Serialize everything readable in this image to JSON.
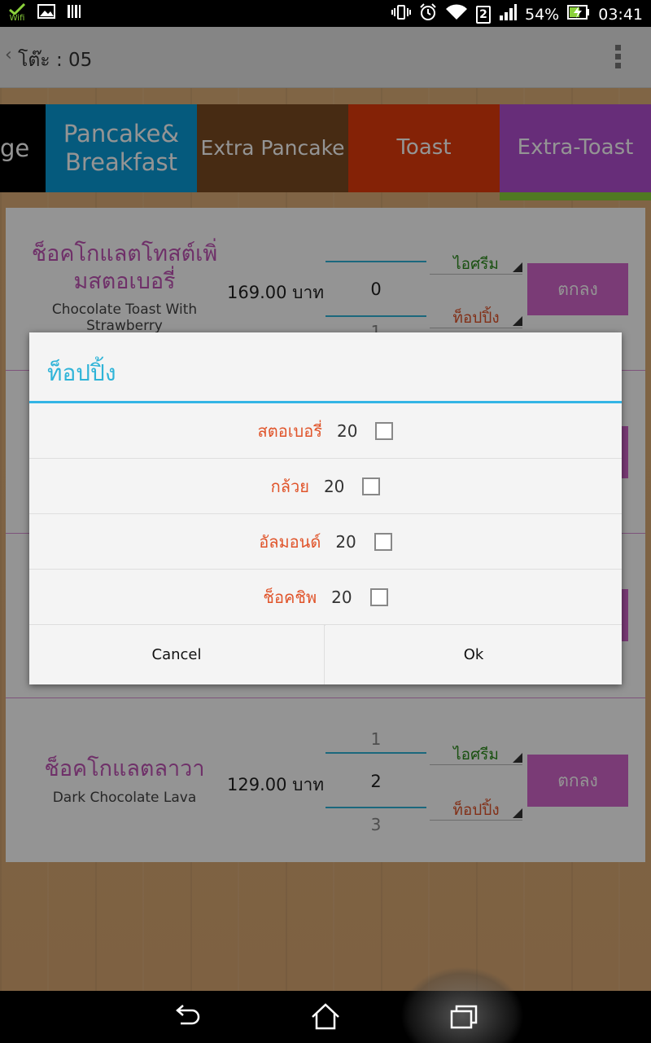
{
  "status_bar": {
    "wifi_label": "Wifi",
    "battery_percent": "54%",
    "time": "03:41",
    "sim_badge": "2",
    "icons": [
      "wifi-app-icon",
      "image-icon",
      "barcode-icon",
      "vibrate-icon",
      "alarm-icon",
      "wifi-signal-icon",
      "sim-icon",
      "cell-signal-icon",
      "battery-charging-icon"
    ]
  },
  "action_bar": {
    "back_glyph": "‹",
    "title": "โต๊ะ : 05"
  },
  "tabs": [
    {
      "label": "ge"
    },
    {
      "label": "Pancake&\nBreakfast"
    },
    {
      "label": "Extra Pancake"
    },
    {
      "label": "Toast"
    },
    {
      "label": "Extra-Toast"
    }
  ],
  "items": [
    {
      "name_th": "ช็อคโกแลตโทสต์เพิ่มสตอเบอรี่",
      "name_th_line1": "ช็อคโกแลตโทสต์เพิ่",
      "name_th_line2": "มสตอเบอรี่",
      "name_en": "Chocolate Toast With",
      "name_en2": "Strawberry",
      "price": "169.00 บาท",
      "qty": "0",
      "qty_next": "1",
      "spinner1": "ไอศรีม",
      "spinner2": "ท็อปปิ้ง",
      "ok_label": "ตกลง"
    },
    {
      "name_th": "ช็อคโกแลตลาวา",
      "name_en": "Dark Chocolate Lava",
      "price": "129.00 บาท",
      "qty_prev": "1",
      "qty": "2",
      "qty_next": "3",
      "spinner1": "ไอศรีม",
      "spinner2": "ท็อปปิ้ง",
      "ok_label": "ตกลง"
    }
  ],
  "dialog": {
    "title": "ท็อปปิ้ง",
    "options": [
      {
        "label": "สตอเบอรี่",
        "price": "20",
        "checked": false
      },
      {
        "label": "กล้วย",
        "price": "20",
        "checked": false
      },
      {
        "label": "อัลมอนด์",
        "price": "20",
        "checked": false
      },
      {
        "label": "ช็อคชิพ",
        "price": "20",
        "checked": false
      }
    ],
    "cancel_label": "Cancel",
    "ok_label": "Ok"
  },
  "nav_bar": {
    "icons": [
      "back-icon",
      "home-icon",
      "recent-apps-icon"
    ]
  },
  "colors": {
    "accent": "#33b5e5",
    "item_name": "#c054b5",
    "option_label": "#e0542a",
    "ok_button": "#d267cc"
  }
}
